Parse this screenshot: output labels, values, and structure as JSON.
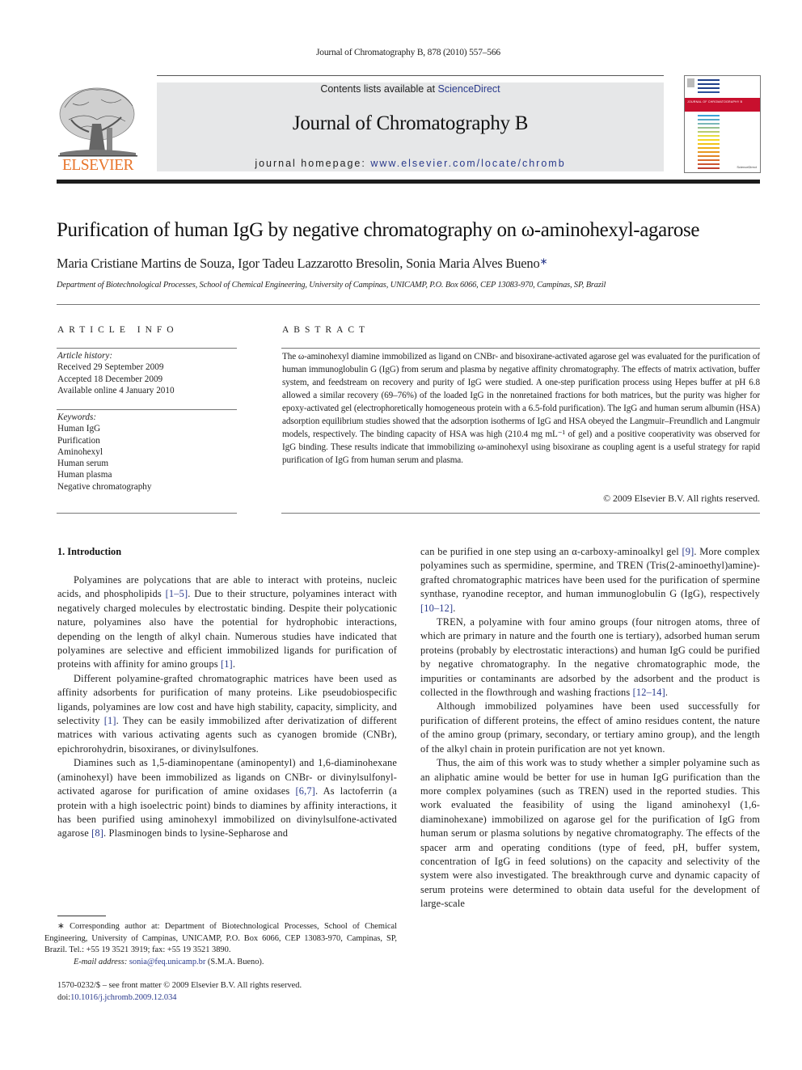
{
  "running_head": "Journal of Chromatography B, 878 (2010) 557–566",
  "masthead": {
    "publisher_logo": "ELSEVIER",
    "contents_prefix": "Contents lists available at ",
    "contents_link": "ScienceDirect",
    "journal_title": "Journal of Chromatography B",
    "homepage_prefix": "journal homepage: ",
    "homepage_link": "www.elsevier.com/locate/chromb",
    "cover_title": "JOURNAL OF CHROMATOGRAPHY B",
    "brand_colors": {
      "elsevier_orange": "#e8742a",
      "link_blue": "#2a3a8c",
      "cover_red": "#c8102e",
      "masthead_gray": "#e6e7e8"
    }
  },
  "article": {
    "title": "Purification of human IgG by negative chromatography on ω-aminohexyl-agarose",
    "authors": "Maria Cristiane Martins de Souza, Igor Tadeu Lazzarotto Bresolin, Sonia Maria Alves Bueno",
    "author_mark": "∗",
    "affiliation": "Department of Biotechnological Processes, School of Chemical Engineering, University of Campinas, UNICAMP, P.O. Box 6066, CEP 13083-970, Campinas, SP, Brazil"
  },
  "article_info": {
    "heading": "ARTICLE INFO",
    "history_label": "Article history:",
    "history": [
      "Received 29 September 2009",
      "Accepted 18 December 2009",
      "Available online 4 January 2010"
    ],
    "keywords_label": "Keywords:",
    "keywords": [
      "Human IgG",
      "Purification",
      "Aminohexyl",
      "Human serum",
      "Human plasma",
      "Negative chromatography"
    ]
  },
  "abstract": {
    "heading": "ABSTRACT",
    "text": "The ω-aminohexyl diamine immobilized as ligand on CNBr- and bisoxirane-activated agarose gel was evaluated for the purification of human immunoglobulin G (IgG) from serum and plasma by negative affinity chromatography. The effects of matrix activation, buffer system, and feedstream on recovery and purity of IgG were studied. A one-step purification process using Hepes buffer at pH 6.8 allowed a similar recovery (69–76%) of the loaded IgG in the nonretained fractions for both matrices, but the purity was higher for epoxy-activated gel (electrophoretically homogeneous protein with a 6.5-fold purification). The IgG and human serum albumin (HSA) adsorption equilibrium studies showed that the adsorption isotherms of IgG and HSA obeyed the Langmuir–Freundlich and Langmuir models, respectively. The binding capacity of HSA was high (210.4 mg mL⁻¹ of gel) and a positive cooperativity was observed for IgG binding. These results indicate that immobilizing ω-aminohexyl using bisoxirane as coupling agent is a useful strategy for rapid purification of IgG from human serum and plasma.",
    "copyright": "© 2009 Elsevier B.V. All rights reserved."
  },
  "introduction": {
    "heading": "1.  Introduction",
    "left_paragraphs": [
      [
        {
          "t": "Polyamines are polycations that are able to interact with proteins, nucleic acids, and phospholipids "
        },
        {
          "t": "[1–5]",
          "link": true
        },
        {
          "t": ". Due to their structure, polyamines interact with negatively charged molecules by electrostatic binding. Despite their polycationic nature, polyamines also have the potential for hydrophobic interactions, depending on the length of alkyl chain. Numerous studies have indicated that polyamines are selective and efficient immobilized ligands for purification of proteins with affinity for amino groups "
        },
        {
          "t": "[1]",
          "link": true
        },
        {
          "t": "."
        }
      ],
      [
        {
          "t": "Different polyamine-grafted chromatographic matrices have been used as affinity adsorbents for purification of many proteins. Like pseudobiospecific ligands, polyamines are low cost and have high stability, capacity, simplicity, and selectivity "
        },
        {
          "t": "[1]",
          "link": true
        },
        {
          "t": ". They can be easily immobilized after derivatization of different matrices with various activating agents such as cyanogen bromide (CNBr), epichrorohydrin, bisoxiranes, or divinylsulfones."
        }
      ],
      [
        {
          "t": "Diamines such as 1,5-diaminopentane (aminopentyl) and 1,6-diaminohexane (aminohexyl) have been immobilized as ligands on CNBr- or divinylsulfonyl-activated agarose for purification of amine oxidases "
        },
        {
          "t": "[6,7]",
          "link": true
        },
        {
          "t": ". As lactoferrin (a protein with a high isoelectric point) binds to diamines by affinity interactions, it has been purified using aminohexyl immobilized on divinylsulfone-activated agarose "
        },
        {
          "t": "[8]",
          "link": true
        },
        {
          "t": ". Plasminogen binds to lysine-Sepharose and"
        }
      ]
    ],
    "right_paragraphs": [
      [
        {
          "t": "can be purified in one step using an α-carboxy-aminoalkyl gel "
        },
        {
          "t": "[9]",
          "link": true
        },
        {
          "t": ". More complex polyamines such as spermidine, spermine, and TREN (Tris(2-aminoethyl)amine)-grafted chromatographic matrices have been used for the purification of spermine synthase, ryanodine receptor, and human immunoglobulin G (IgG), respectively "
        },
        {
          "t": "[10–12]",
          "link": true
        },
        {
          "t": "."
        }
      ],
      [
        {
          "t": "TREN, a polyamine with four amino groups (four nitrogen atoms, three of which are primary in nature and the fourth one is tertiary), adsorbed human serum proteins (probably by electrostatic interactions) and human IgG could be purified by negative chromatography. In the negative chromatographic mode, the impurities or contaminants are adsorbed by the adsorbent and the product is collected in the flowthrough and washing fractions "
        },
        {
          "t": "[12–14]",
          "link": true
        },
        {
          "t": "."
        }
      ],
      [
        {
          "t": "Although immobilized polyamines have been used successfully for purification of different proteins, the effect of amino residues content, the nature of the amino group (primary, secondary, or tertiary amino group), and the length of the alkyl chain in protein purification are not yet known."
        }
      ],
      [
        {
          "t": "Thus, the aim of this work was to study whether a simpler polyamine such as an aliphatic amine would be better for use in human IgG purification than the more complex polyamines (such as TREN) used in the reported studies. This work evaluated the feasibility of using the ligand aminohexyl (1,6-diaminohexane) immobilized on agarose gel for the purification of IgG from human serum or plasma solutions by negative chromatography. The effects of the spacer arm and operating conditions (type of feed, pH, buffer system, concentration of IgG in feed solutions) on the capacity and selectivity of the system were also investigated. The breakthrough curve and dynamic capacity of serum proteins were determined to obtain data useful for the development of large-scale"
        }
      ]
    ]
  },
  "footnote": {
    "mark": "∗",
    "text": "Corresponding author at: Department of Biotechnological Processes, School of Chemical Engineering, University of Campinas, UNICAMP, P.O. Box 6066, CEP 13083-970, Campinas, SP, Brazil. Tel.: +55 19 3521 3919; fax: +55 19 3521 3890.",
    "email_label": "E-mail address:",
    "email": "sonia@feq.unicamp.br",
    "email_owner": "(S.M.A. Bueno)."
  },
  "front_matter": {
    "issn_line": "1570-0232/$ – see front matter © 2009 Elsevier B.V. All rights reserved.",
    "doi_prefix": "doi:",
    "doi": "10.1016/j.jchromb.2009.12.034"
  }
}
